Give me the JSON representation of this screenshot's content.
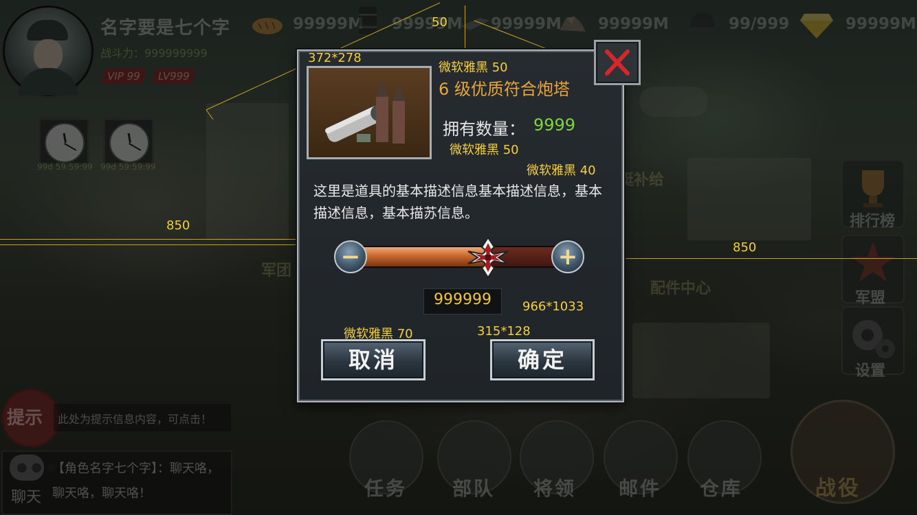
{
  "header": {
    "player_name": "名字要是七个字",
    "power": "战斗力：999999999",
    "vip": "VIP 99",
    "level": "LV999",
    "resources": [
      {
        "icon": "bread-icon",
        "value": "99999M"
      },
      {
        "icon": "oil-barrel-icon",
        "value": "99999M"
      },
      {
        "icon": "steel-bar-icon",
        "value": "99999M"
      },
      {
        "icon": "ore-icon",
        "value": "99999M"
      },
      {
        "icon": "helmet-icon",
        "value": "99/999"
      },
      {
        "icon": "diamond-icon",
        "value": "99999M"
      }
    ]
  },
  "timers": [
    "99d 59:59:99",
    "99d 59:59:99"
  ],
  "map_labels": {
    "airship_supply": "艇补给",
    "legion": "军团",
    "parts_center": "配件中心"
  },
  "side_menu": {
    "ranking": "排行榜",
    "alliance": "军盟",
    "settings": "设置"
  },
  "tip": {
    "label": "提示",
    "text": "此处为提示信息内容，可点击！"
  },
  "chat": {
    "label": "聊天",
    "line1": "【角色名字七个字】：聊天咯，",
    "line2": "聊天咯，聊天咯！"
  },
  "bottom_nav": [
    "任务",
    "部队",
    "将领",
    "邮件",
    "仓库"
  ],
  "battle_label": "战役",
  "dialog": {
    "item_name": "6 级优质符合炮塔",
    "owned_label": "拥有数量：",
    "owned_count": "9999",
    "description": "这里是道具的基本描述信息基本描述信息，基本描述信息，基本描苏信息。",
    "minus": "−",
    "plus": "+",
    "quantity": "999999",
    "slider_fraction": 0.64,
    "cancel": "取消",
    "confirm": "确定"
  },
  "annotations": {
    "img_size": "372*278",
    "title_font": "微软雅黑 50",
    "count_font": "微软雅黑 50",
    "desc_font": "微软雅黑 40",
    "btn_font": "微软雅黑 70",
    "btn_size": "315*128",
    "dialog_size": "966*1033",
    "dim_top": "50",
    "dim_left": "850",
    "dim_right": "850"
  },
  "colors": {
    "accent_orange": "#e8a63a",
    "count_green": "#7ed640",
    "annotation_yellow": "#f5d03c"
  }
}
